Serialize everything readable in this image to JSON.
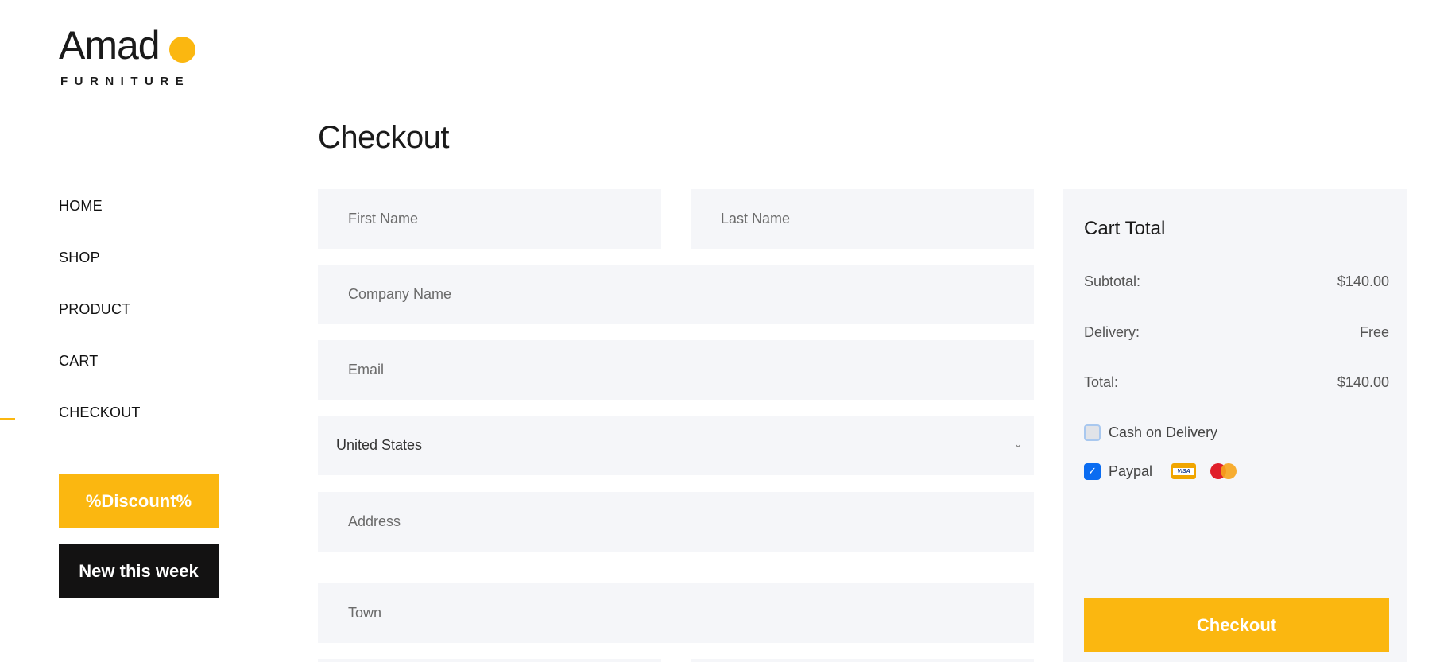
{
  "logo": {
    "wordmark": "Amad",
    "subtitle": "FURNITURE",
    "accent": "#fbb710"
  },
  "nav": {
    "items": [
      {
        "label": "HOME",
        "active": false
      },
      {
        "label": "SHOP",
        "active": false
      },
      {
        "label": "PRODUCT",
        "active": false
      },
      {
        "label": "CART",
        "active": false
      },
      {
        "label": "CHECKOUT",
        "active": true
      }
    ]
  },
  "promos": {
    "discount_label": "%Discount%",
    "new_label": "New this week"
  },
  "page": {
    "title": "Checkout"
  },
  "form": {
    "first_name": {
      "placeholder": "First Name",
      "value": ""
    },
    "last_name": {
      "placeholder": "Last Name",
      "value": ""
    },
    "company": {
      "placeholder": "Company Name",
      "value": ""
    },
    "email": {
      "placeholder": "Email",
      "value": ""
    },
    "country": {
      "selected": "United States"
    },
    "address": {
      "placeholder": "Address",
      "value": ""
    },
    "town": {
      "placeholder": "Town",
      "value": ""
    }
  },
  "cart": {
    "title": "Cart Total",
    "subtotal_label": "Subtotal:",
    "subtotal_value": "$140.00",
    "delivery_label": "Delivery:",
    "delivery_value": "Free",
    "total_label": "Total:",
    "total_value": "$140.00",
    "payment": {
      "cash_label": "Cash on Delivery",
      "cash_checked": false,
      "paypal_label": "Paypal",
      "paypal_checked": true,
      "card_icons": [
        "visa-icon",
        "mastercard-icon"
      ]
    },
    "checkout_label": "Checkout"
  },
  "colors": {
    "accent": "#fbb710",
    "dark": "#131212",
    "field_bg": "#f5f6f9",
    "checkbox_blue": "#0a6cf1"
  }
}
